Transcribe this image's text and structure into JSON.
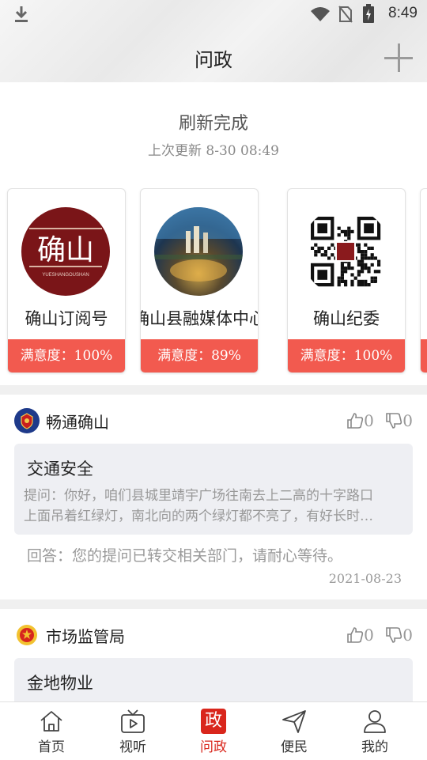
{
  "status_bar": {
    "time": "8:49"
  },
  "header": {
    "title": "问政"
  },
  "refresh": {
    "title": "刷新完成",
    "subtitle": "上次更新 8-30 08:49"
  },
  "accounts": [
    {
      "name": "确山订阅号",
      "satisfaction": "满意度：100%",
      "logo_text": "确山",
      "logo_sub": "YUESHANGOUSHAN"
    },
    {
      "name": "确山县融媒体中心",
      "satisfaction": "满意度：89%"
    },
    {
      "name": "确山纪委",
      "satisfaction": "满意度：100%"
    }
  ],
  "posts": [
    {
      "source": "畅通确山",
      "likes": "0",
      "dislikes": "0",
      "question_title": "交通安全",
      "question_line1": "提问：你好，咱们县城里靖宇广场往南去上二高的十字路口",
      "question_line2": "上面吊着红绿灯，南北向的两个绿灯都不亮了，有好长时…",
      "answer": "回答：您的提问已转交相关部门，请耐心等待。",
      "date": "2021-08-23"
    },
    {
      "source": "市场监管局",
      "likes": "0",
      "dislikes": "0",
      "question_title": "金地物业"
    }
  ],
  "tabbar": {
    "items": [
      {
        "label": "首页",
        "icon": "home-icon"
      },
      {
        "label": "视听",
        "icon": "tv-icon"
      },
      {
        "label": "问政",
        "icon": "zheng-icon",
        "icon_text": "政",
        "active": true
      },
      {
        "label": "便民",
        "icon": "paper-plane-icon"
      },
      {
        "label": "我的",
        "icon": "user-icon"
      }
    ]
  },
  "colors": {
    "accent": "#d9261c",
    "satisfaction_bar": "#f25a4f"
  }
}
